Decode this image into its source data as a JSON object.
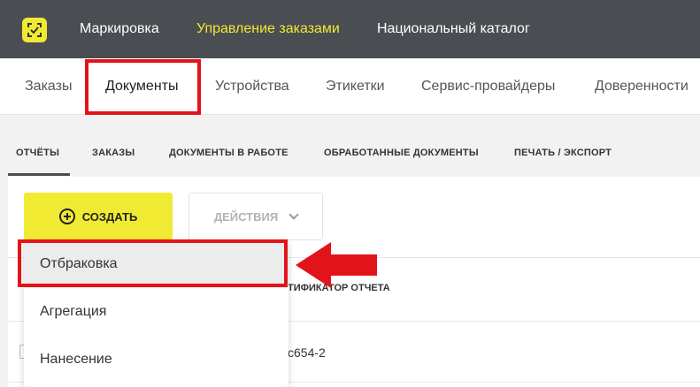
{
  "topbar": {
    "items": [
      {
        "label": "Маркировка"
      },
      {
        "label": "Управление заказами"
      },
      {
        "label": "Национальный каталог"
      }
    ]
  },
  "subnav": {
    "items": [
      {
        "label": "Заказы"
      },
      {
        "label": "Документы"
      },
      {
        "label": "Устройства"
      },
      {
        "label": "Этикетки"
      },
      {
        "label": "Сервис-провайдеры"
      },
      {
        "label": "Доверенности"
      }
    ]
  },
  "tabs": {
    "items": [
      {
        "label": "ОТЧЁТЫ"
      },
      {
        "label": "ЗАКАЗЫ"
      },
      {
        "label": "ДОКУМЕНТЫ В РАБОТЕ"
      },
      {
        "label": "ОБРАБОТАННЫЕ ДОКУМЕНТЫ"
      },
      {
        "label": "ПЕЧАТЬ / ЭКСПОРТ"
      }
    ]
  },
  "toolbar": {
    "create_label": "СОЗДАТЬ",
    "actions_label": "ДЕЙСТВИЯ"
  },
  "dropdown": {
    "items": [
      {
        "label": "Отбраковка"
      },
      {
        "label": "Агрегация"
      },
      {
        "label": "Нанесение"
      }
    ]
  },
  "table": {
    "header_fragment": "ТИФИКАТОР ОТЧЕТА",
    "row_fragment": "c654-2"
  },
  "colors": {
    "accent": "#f0ea33",
    "topbar": "#4a4d52",
    "highlight_box": "#e3131b"
  }
}
